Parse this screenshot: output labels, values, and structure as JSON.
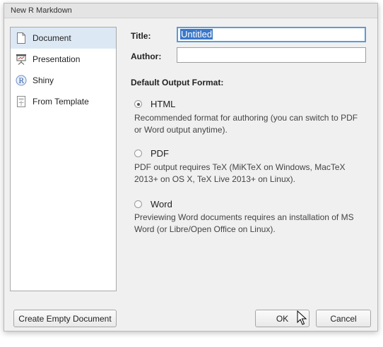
{
  "window": {
    "title": "New R Markdown"
  },
  "sidebar": {
    "items": [
      {
        "label": "Document",
        "icon": "document-icon",
        "selected": true
      },
      {
        "label": "Presentation",
        "icon": "presentation-icon",
        "selected": false
      },
      {
        "label": "Shiny",
        "icon": "shiny-r-icon",
        "selected": false
      },
      {
        "label": "From Template",
        "icon": "template-icon",
        "selected": false
      }
    ]
  },
  "form": {
    "title_label": "Title:",
    "title_value": "Untitled",
    "author_label": "Author:",
    "author_value": "",
    "output_heading": "Default Output Format:"
  },
  "formats": [
    {
      "label": "HTML",
      "checked": true,
      "description_1": "Recommended format for authoring (you can switch to PDF",
      "description_2": "or Word output anytime)."
    },
    {
      "label": "PDF",
      "checked": false,
      "description_1": "PDF output requires TeX (MiKTeX on Windows, MacTeX",
      "description_2": "2013+ on OS X, TeX Live 2013+ on Linux)."
    },
    {
      "label": "Word",
      "checked": false,
      "description_1": "Previewing Word documents requires an installation of MS",
      "description_2": "Word (or Libre/Open Office on Linux)."
    }
  ],
  "buttons": {
    "create_empty": "Create Empty Document",
    "ok": "OK",
    "cancel": "Cancel"
  },
  "colors": {
    "selection": "#dde8f5",
    "focus_border": "#5b9bd5",
    "text_selection": "#3a77c9"
  }
}
